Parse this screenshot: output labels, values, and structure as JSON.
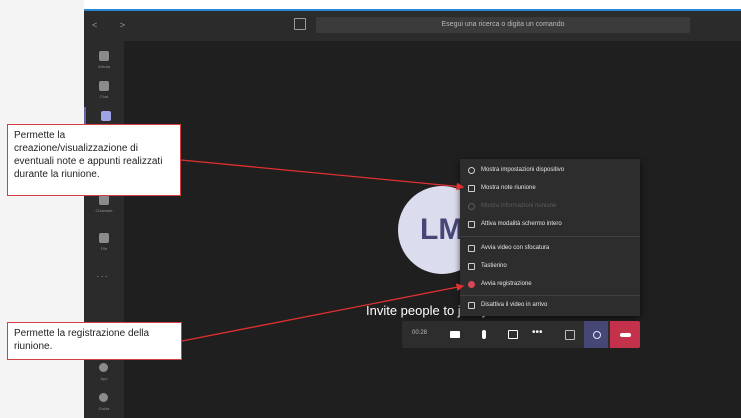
{
  "app": {
    "nav_arrows": "< >",
    "search_placeholder": "Esegui una ricerca o digita un comando"
  },
  "rail": {
    "items": [
      {
        "icon": "bell-icon",
        "label": "Attività"
      },
      {
        "icon": "chat-icon",
        "label": "Chat"
      },
      {
        "icon": "teams-icon",
        "label": "Team"
      },
      {
        "icon": "calendar-icon",
        "label": "Calendario"
      },
      {
        "icon": "phone-icon",
        "label": "Chiamate"
      },
      {
        "icon": "file-icon",
        "label": "File"
      }
    ],
    "more": "···",
    "bottom_items": [
      {
        "icon": "apps-icon",
        "label": "App"
      },
      {
        "icon": "help-icon",
        "label": "Guida"
      }
    ]
  },
  "meeting": {
    "avatar_initials": "LM",
    "invite_text": "Invite people to join you",
    "timer": "00:28"
  },
  "menu": {
    "items": [
      {
        "icon": "gear-icon",
        "label": "Mostra impostazioni dispositivo",
        "enabled": true
      },
      {
        "icon": "notes-icon",
        "label": "Mostra note riunione",
        "enabled": true
      },
      {
        "icon": "info-icon",
        "label": "Mostra informazioni riunione",
        "enabled": false
      },
      {
        "icon": "fullscreen-icon",
        "label": "Attiva modalità schermo intero",
        "enabled": true
      },
      {
        "icon": "blur-icon",
        "label": "Avvia video con sfocatura",
        "enabled": true
      },
      {
        "icon": "keypad-icon",
        "label": "Tastierino",
        "enabled": true
      },
      {
        "icon": "record-icon",
        "label": "Avvia registrazione",
        "enabled": true
      },
      {
        "icon": "video-off-icon",
        "label": "Disattiva il video in arrivo",
        "enabled": true
      }
    ]
  },
  "callouts": {
    "notes": "Permette la creazione/visualizzazione di eventuali note e appunti realizzati durante la riunione.",
    "recording": "Permette la registrazione della riunione."
  },
  "colors": {
    "accent": "#6264a7",
    "hangup": "#c4314b",
    "callout_border": "#d04040",
    "arrow": "#e03030"
  }
}
